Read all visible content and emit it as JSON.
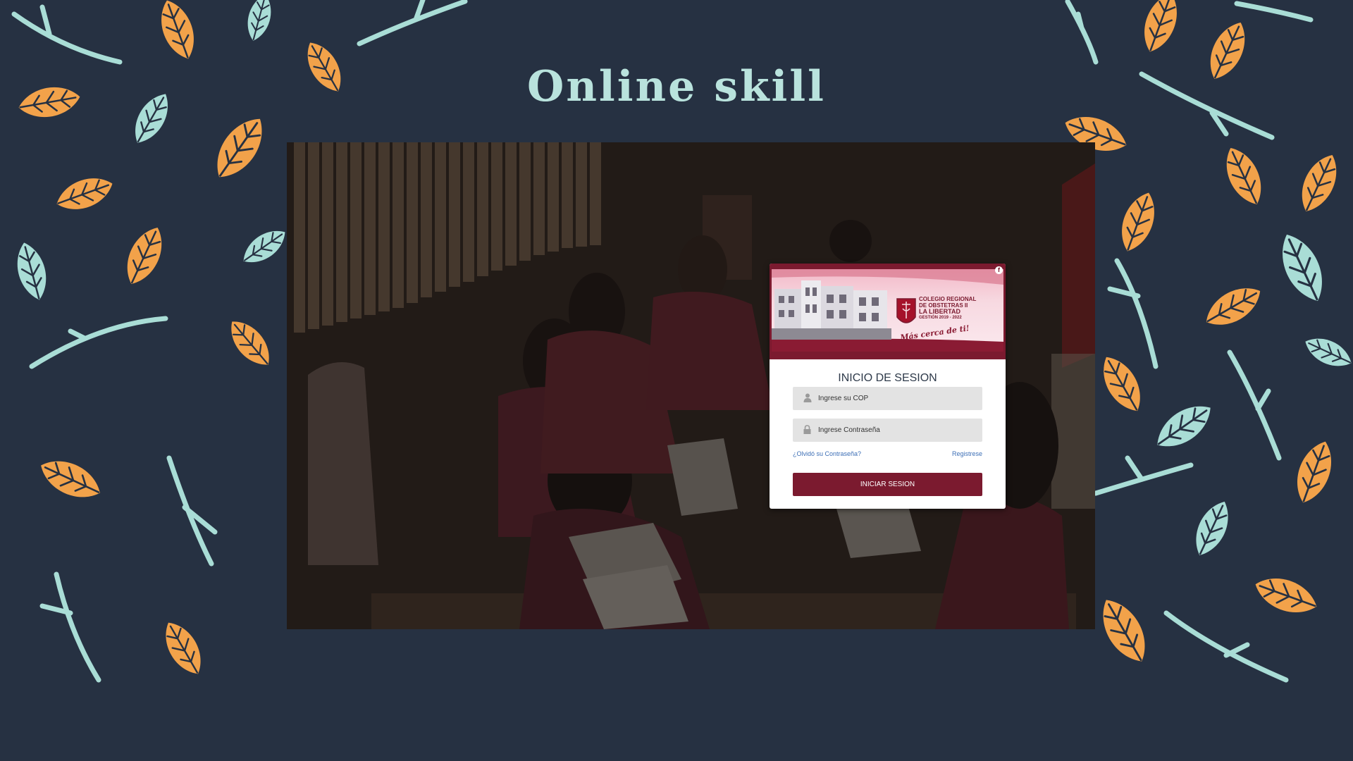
{
  "slide": {
    "title": "Online skill"
  },
  "login": {
    "banner": {
      "org_line1": "COLEGIO REGIONAL",
      "org_line2": "DE OBSTETRAS II",
      "org_line3": "LA LIBERTAD",
      "org_line4": "GESTIÓN 2019 - 2022",
      "slogan": "Más cerca de ti!"
    },
    "form_title": "INICIO DE SESION",
    "cop_placeholder": "Ingrese su COP",
    "password_placeholder": "Ingrese Contraseña",
    "forgot_link": "¿Olvidó su Contraseña?",
    "register_link": "Registrese",
    "submit_label": "INICIAR SESION",
    "icons": {
      "user": "user-icon",
      "lock": "lock-icon",
      "facebook": "facebook-icon"
    },
    "colors": {
      "brand": "#7b1a2f",
      "link": "#3d6fb6",
      "field_bg": "#e3e3e3"
    }
  },
  "colors": {
    "background": "#263142",
    "title": "#b9e3dd",
    "leaf_orange": "#f2a24a",
    "leaf_teal": "#a9ddd6"
  }
}
